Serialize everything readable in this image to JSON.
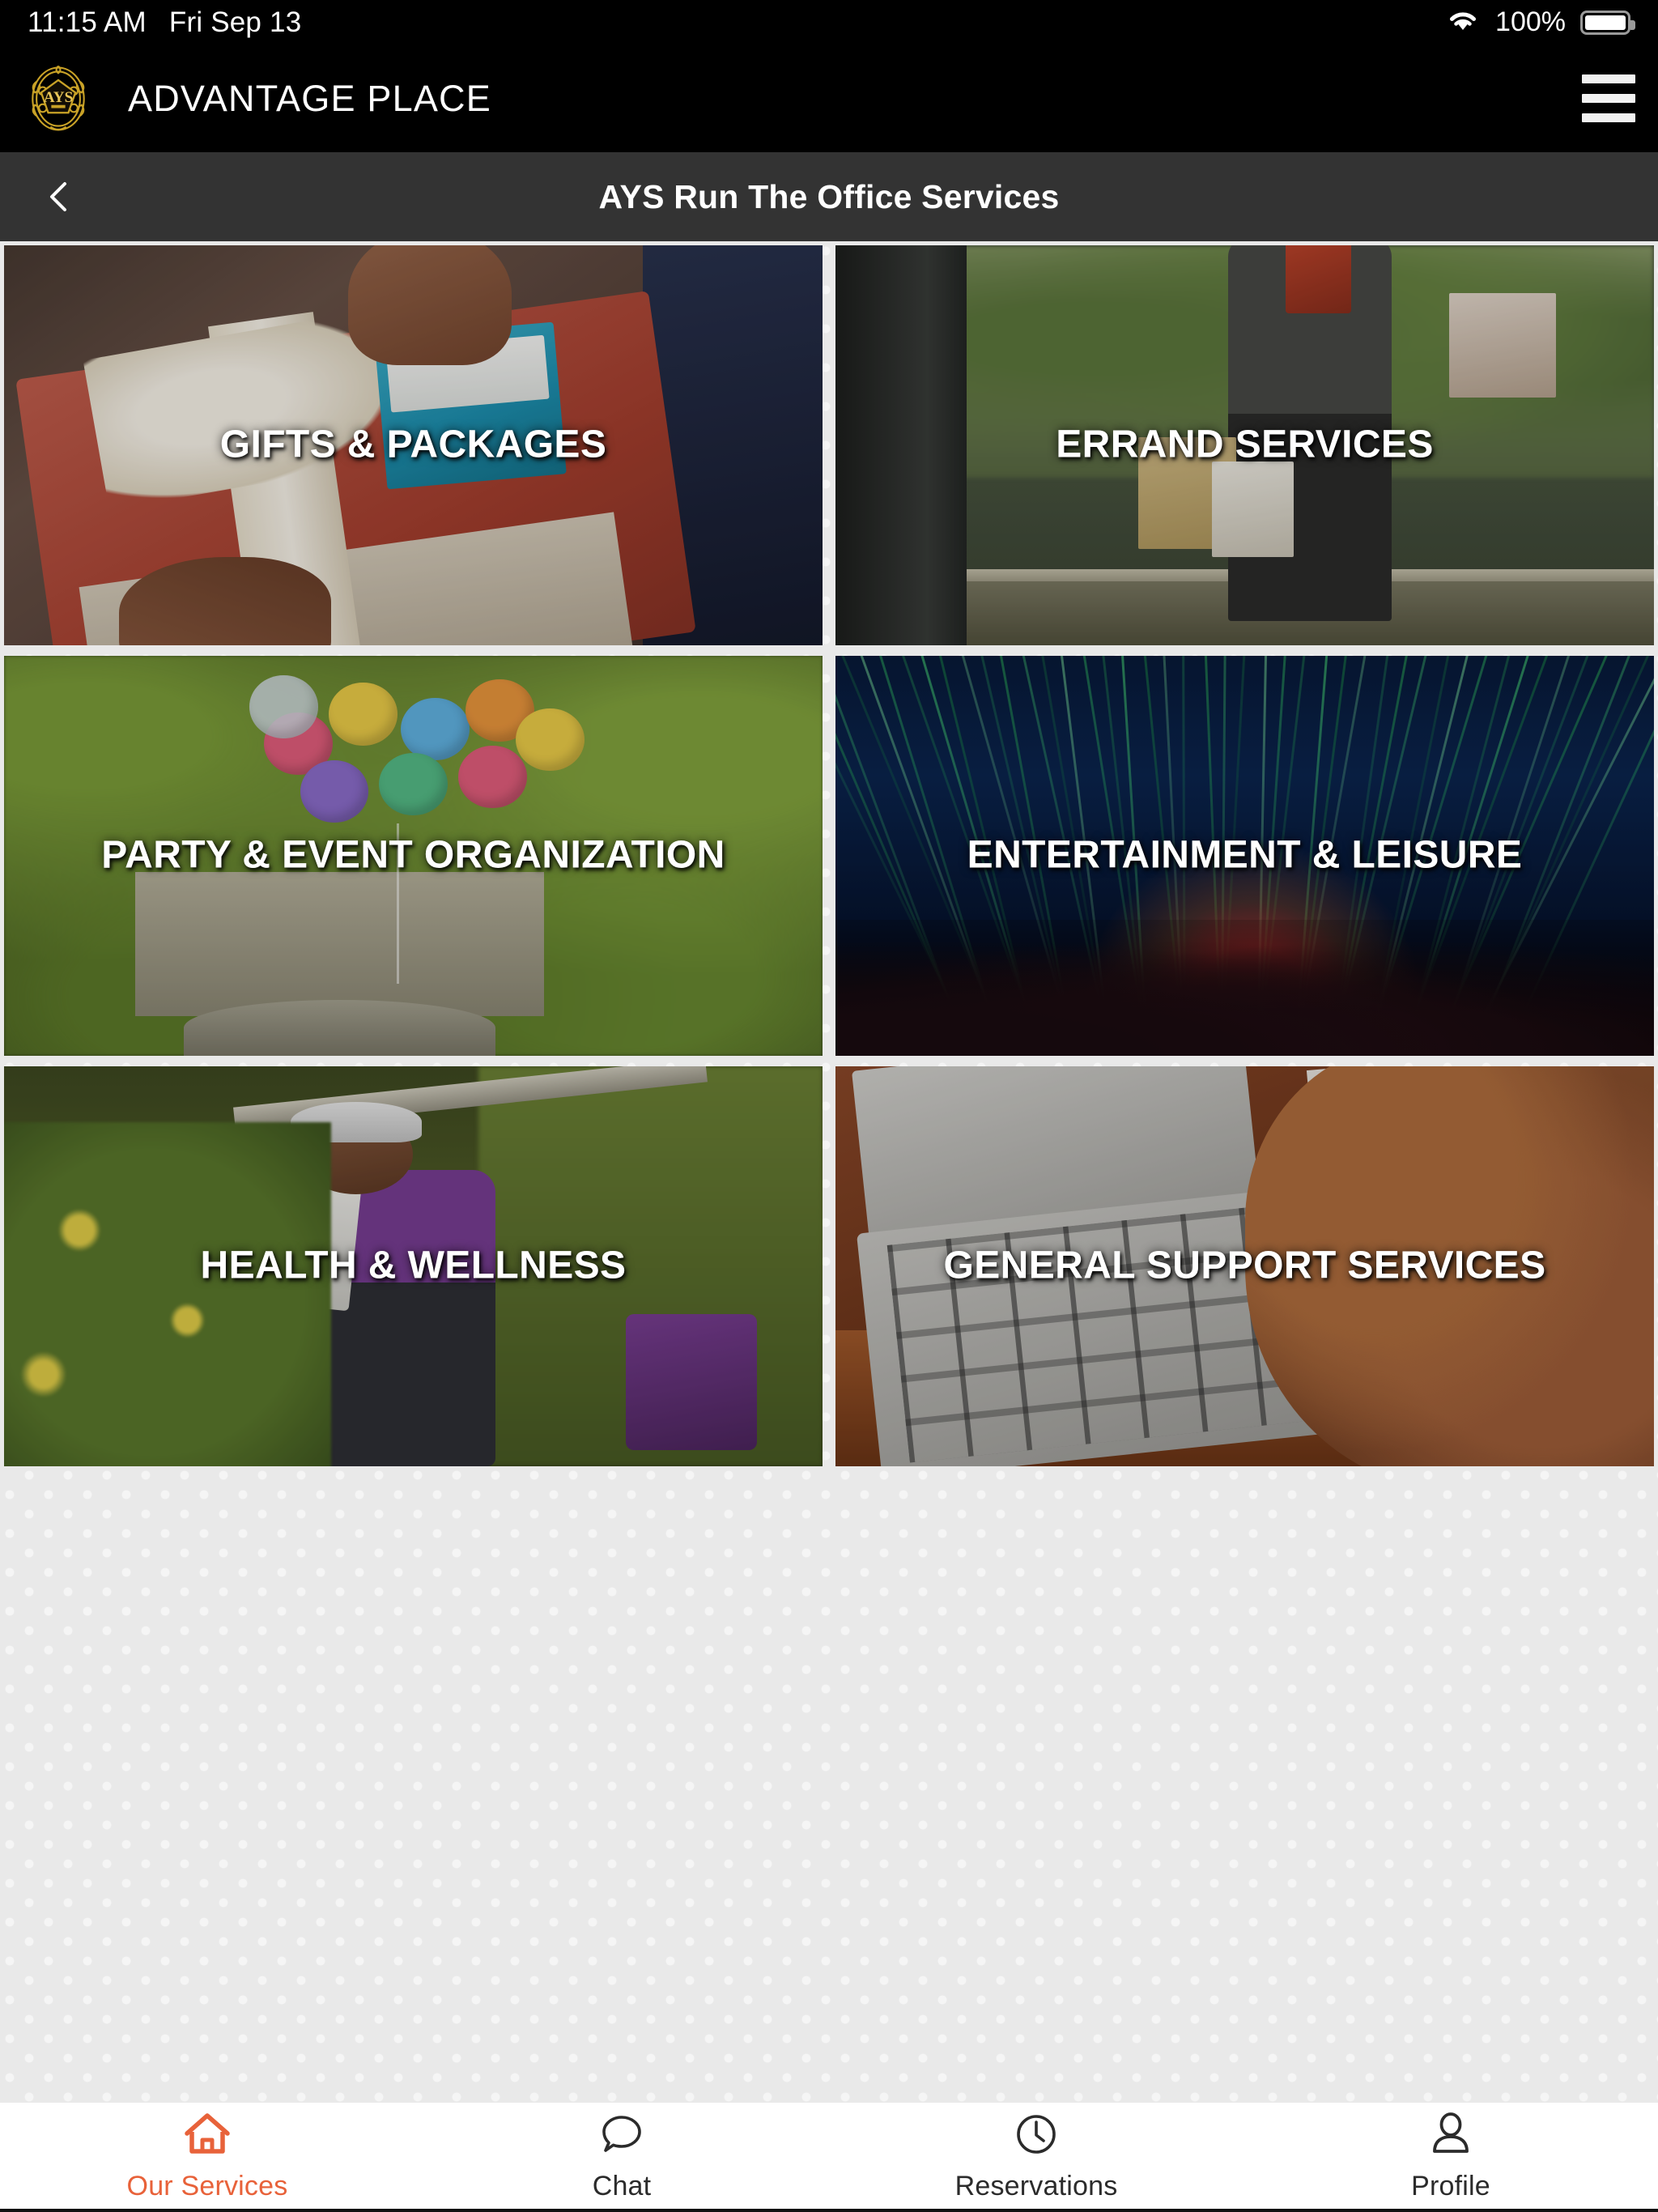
{
  "status_bar": {
    "time": "11:15 AM",
    "date": "Fri Sep 13",
    "battery_percent": "100%",
    "wifi_icon": "wifi-icon",
    "battery_icon": "battery-full-icon"
  },
  "app_header": {
    "brand": "ADVANTAGE PLACE",
    "logo_icon": "ays-crest-logo",
    "logo_monogram": "AYS",
    "menu_icon": "hamburger-menu-icon",
    "background_color": "#000000"
  },
  "title_bar": {
    "title": "AYS Run The Office Services",
    "back_icon": "chevron-left-icon",
    "background_color": "#333333"
  },
  "services": {
    "tiles": [
      {
        "label": "GIFTS & PACKAGES",
        "art": "art-gifts"
      },
      {
        "label": "ERRAND SERVICES",
        "art": "art-errand"
      },
      {
        "label": "PARTY & EVENT ORGANIZATION",
        "art": "art-party"
      },
      {
        "label": "ENTERTAINMENT & LEISURE",
        "art": "art-ent"
      },
      {
        "label": "HEALTH & WELLNESS",
        "art": "art-health"
      },
      {
        "label": "GENERAL SUPPORT SERVICES",
        "art": "art-gs"
      }
    ],
    "background_color": "#e9e9e9"
  },
  "tab_bar": {
    "active_color": "#e8623a",
    "inactive_color": "#2b2b2b",
    "items": [
      {
        "label": "Our Services",
        "icon": "home-icon",
        "active": true
      },
      {
        "label": "Chat",
        "icon": "chat-bubble-icon",
        "active": false
      },
      {
        "label": "Reservations",
        "icon": "clock-icon",
        "active": false
      },
      {
        "label": "Profile",
        "icon": "person-icon",
        "active": false
      }
    ]
  }
}
